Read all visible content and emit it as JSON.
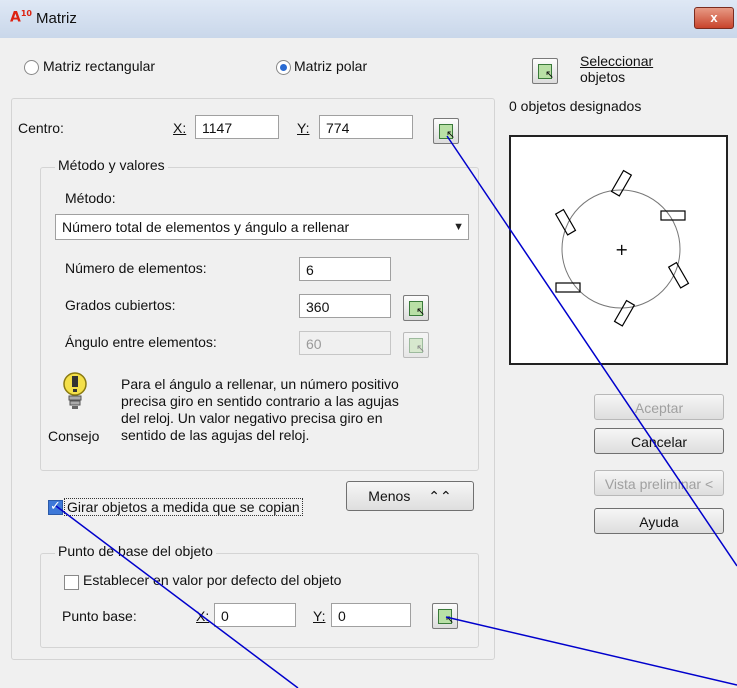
{
  "window": {
    "title": "Matriz",
    "logo_text": "A",
    "logo_sup": "10",
    "close_label": "x"
  },
  "modes": {
    "rect_label": "Matriz rectangular",
    "polar_label": "Matriz polar",
    "selected": "polar"
  },
  "select_objects": {
    "label_line1": "Seleccionar",
    "label_line2": "objetos",
    "count_text": "0 objetos designados"
  },
  "center": {
    "label": "Centro:",
    "x_label": "X:",
    "x_value": "1147",
    "y_label": "Y:",
    "y_value": "774"
  },
  "method_group": {
    "legend": "Método y valores",
    "method_label": "Método:",
    "method_value": "Número total de elementos y ángulo a rellenar",
    "num_label": "Número de elementos:",
    "num_value": "6",
    "deg_label": "Grados cubiertos:",
    "deg_value": "360",
    "angle_label": "Ángulo entre elementos:",
    "angle_value": "60"
  },
  "tip": {
    "label": "Consejo",
    "line1": "Para el ángulo a rellenar, un número positivo",
    "line2": "precisa giro en sentido contrario a las agujas",
    "line3": "del reloj. Un valor negativo precisa giro en",
    "line4": "sentido de las agujas del reloj."
  },
  "rotate": {
    "label": "Girar objetos a medida que se copian",
    "checked": true
  },
  "less_button": {
    "label": "Menos",
    "icon": "double-chevron-up-icon"
  },
  "base_group": {
    "legend": "Punto de base del objeto",
    "default_label": "Establecer en valor por defecto del objeto",
    "default_checked": false,
    "base_label": "Punto base:",
    "x_label": "X:",
    "x_value": "0",
    "y_label": "Y:",
    "y_value": "0"
  },
  "buttons": {
    "ok": "Aceptar",
    "cancel": "Cancelar",
    "preview": "Vista preliminar <",
    "help": "Ayuda"
  },
  "colors": {
    "annotation_line": "#0000cc",
    "checkbox_on": "#3d78d8"
  }
}
